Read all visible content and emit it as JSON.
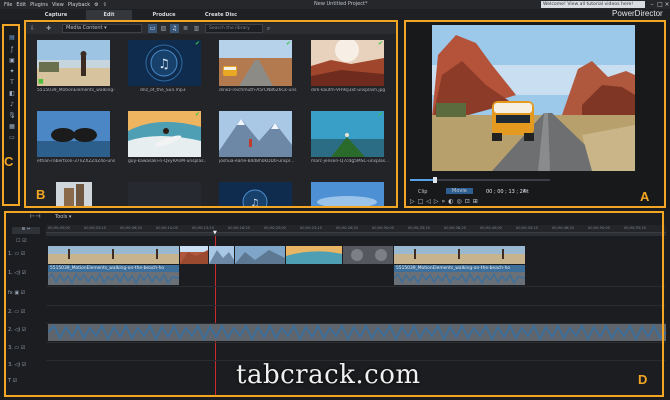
{
  "app": {
    "title": "New Untitled Project*",
    "brand": "PowerDirector",
    "welcome": "Welcome! View all tutorial videos here!",
    "menu": [
      "File",
      "Edit",
      "Plugins",
      "View",
      "Playback"
    ]
  },
  "tabs": [
    "Capture",
    "Edit",
    "Produce",
    "Create Disc"
  ],
  "library": {
    "dropdown": "Media Content",
    "search_placeholder": "Search the library",
    "items": [
      {
        "caption": "5515039_MotionElements_walking-..."
      },
      {
        "caption": "dnz_of_the_Sun.mp3"
      },
      {
        "caption": "dinoz-reichmuth-A5rCN8626Ck-uns..."
      },
      {
        "caption": "dirk-kaufm-VH9sJ3xt-unsplash.jpg"
      },
      {
        "caption": "ethan-robertson-37nZXZZ4Z4o-uns..."
      },
      {
        "caption": "guy-kawasaki-n-QxyRAnM-unsplas..."
      },
      {
        "caption": "joshua-earle-B4d8h0kDD0-unspl..."
      },
      {
        "caption": "marc-jensen-Q7cdg5MSC-unsplas..."
      }
    ]
  },
  "preview": {
    "clip_label": "Clip",
    "movie_label": "Movie",
    "timecode": "00 ; 00 ; 13 ; 24",
    "fit": "Fit"
  },
  "timeline": {
    "tools_label": "Tools",
    "ruler": [
      "00;00;00;00",
      "00;00;03;10",
      "00;00;06;20",
      "00;00;10;00",
      "00;00;13;10",
      "00;00;16;20",
      "00;00;20;00",
      "00;00;23;10",
      "00;00;26;20",
      "00;00;30;00",
      "00;00;33;10",
      "00;00;36;20",
      "00;00;40;00",
      "00;00;43;10",
      "00;00;46;20",
      "00;00;50;00",
      "00;00;53;10"
    ],
    "clip_label_1": "5515039_MotionElements_walking-on-the-beach-ho",
    "clip_label_2": "5515039_MotionElements_walking-on-the-beach-ho",
    "track_labels": [
      "1.",
      "1.",
      "fx",
      "2.",
      "2.",
      "3.",
      "3.",
      "T"
    ]
  },
  "markers": [
    "A",
    "B",
    "C",
    "D"
  ],
  "watermark": "tabcrack.com",
  "colors": {
    "accent_frame": "#f2a623",
    "selection_blue": "#3a5676",
    "audio_wave": "#3d6f9a"
  }
}
